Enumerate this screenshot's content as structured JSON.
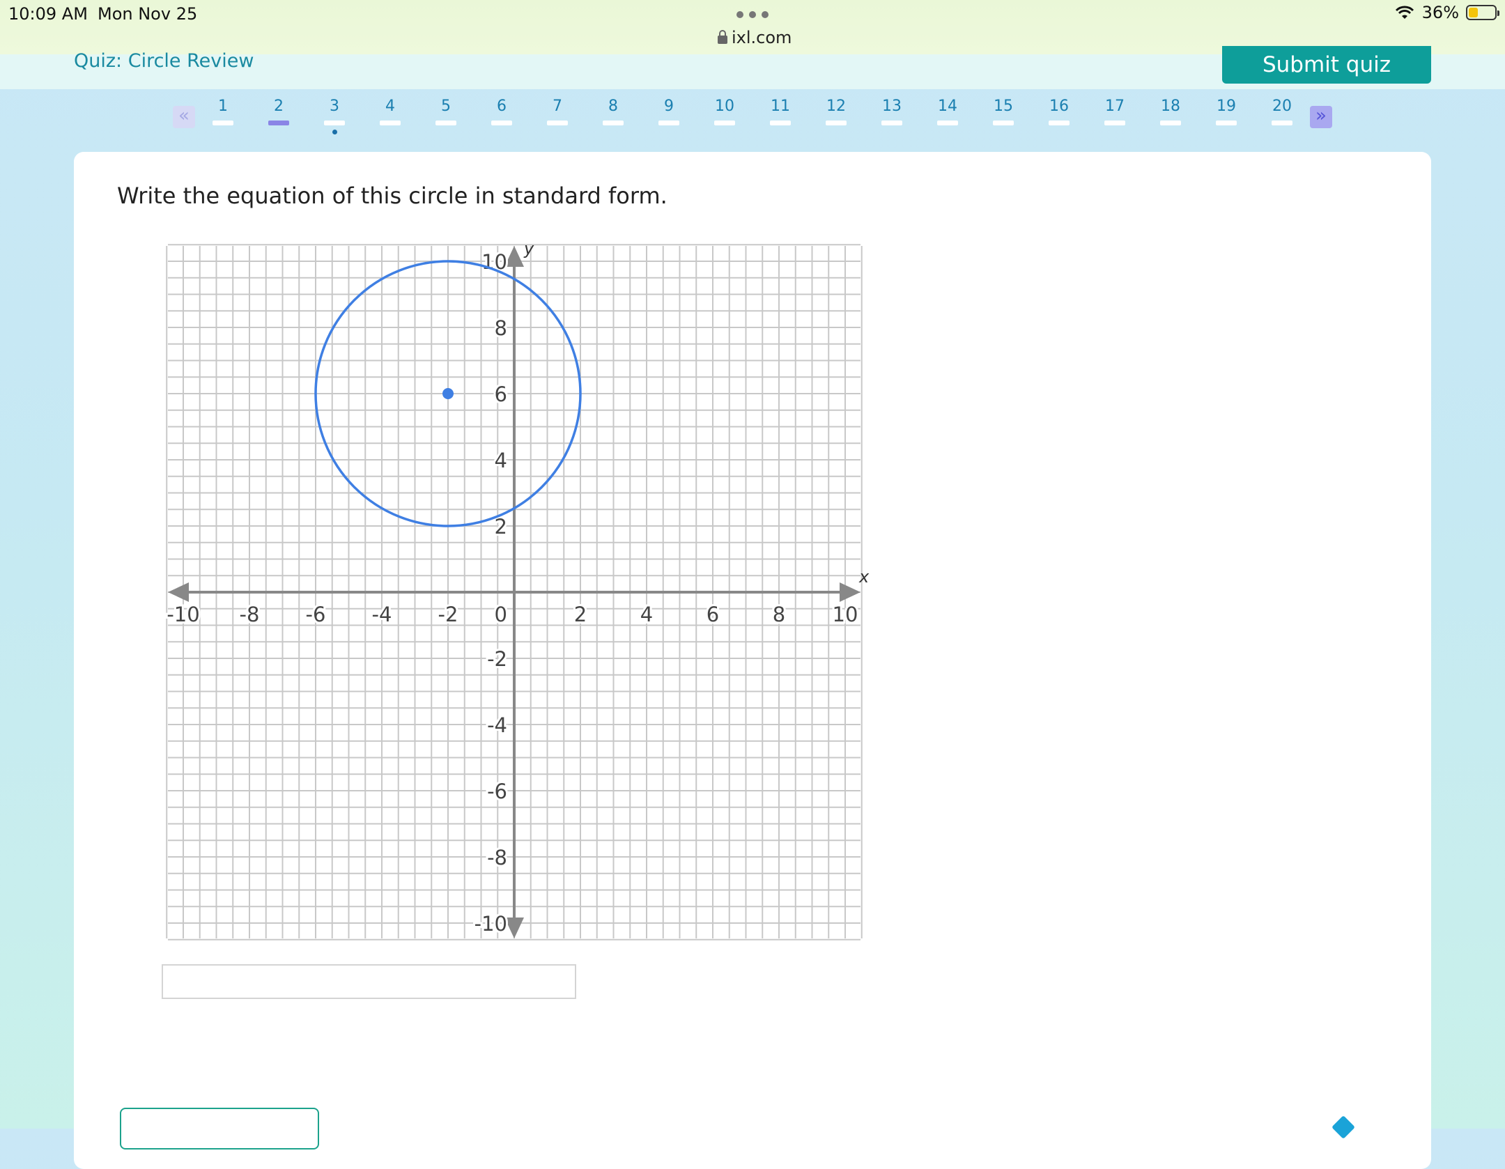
{
  "status_bar": {
    "time": "10:09 AM",
    "date": "Mon Nov 25",
    "url": "ixl.com",
    "battery": "36%",
    "battery_level": 0.36
  },
  "quiz": {
    "title": "Quiz: Circle Review",
    "submit_label": "Submit quiz",
    "current_question": 2,
    "answered_marker_question": 3,
    "questions": [
      "1",
      "2",
      "3",
      "4",
      "5",
      "6",
      "7",
      "8",
      "9",
      "10",
      "11",
      "12",
      "13",
      "14",
      "15",
      "16",
      "17",
      "18",
      "19",
      "20"
    ],
    "prev_icon": "double-chevron-left-icon",
    "next_icon": "double-chevron-right-icon"
  },
  "question": {
    "prompt": "Write the equation of this circle in standard form.",
    "answer_value": ""
  },
  "chart_data": {
    "type": "scatter",
    "x_axis_label": "x",
    "y_axis_label": "y",
    "xlim": [
      -10,
      10
    ],
    "ylim": [
      -10,
      10
    ],
    "grid": true,
    "x_ticks": [
      "-10",
      "-8",
      "-6",
      "-4",
      "-2",
      "0",
      "2",
      "4",
      "6",
      "8",
      "10"
    ],
    "y_ticks": [
      "10",
      "8",
      "6",
      "4",
      "2",
      "-2",
      "-4",
      "-6",
      "-8",
      "-10"
    ],
    "circle": {
      "center": [
        -2,
        6
      ],
      "radius": 4
    },
    "colors": {
      "circle": "#3f7fe3",
      "axes": "#888888",
      "grid": "#c8c8c8"
    }
  },
  "colors": {
    "accent": "#0e9e9a",
    "link": "#1a8aa0",
    "active_bar": "#8a85e6"
  }
}
